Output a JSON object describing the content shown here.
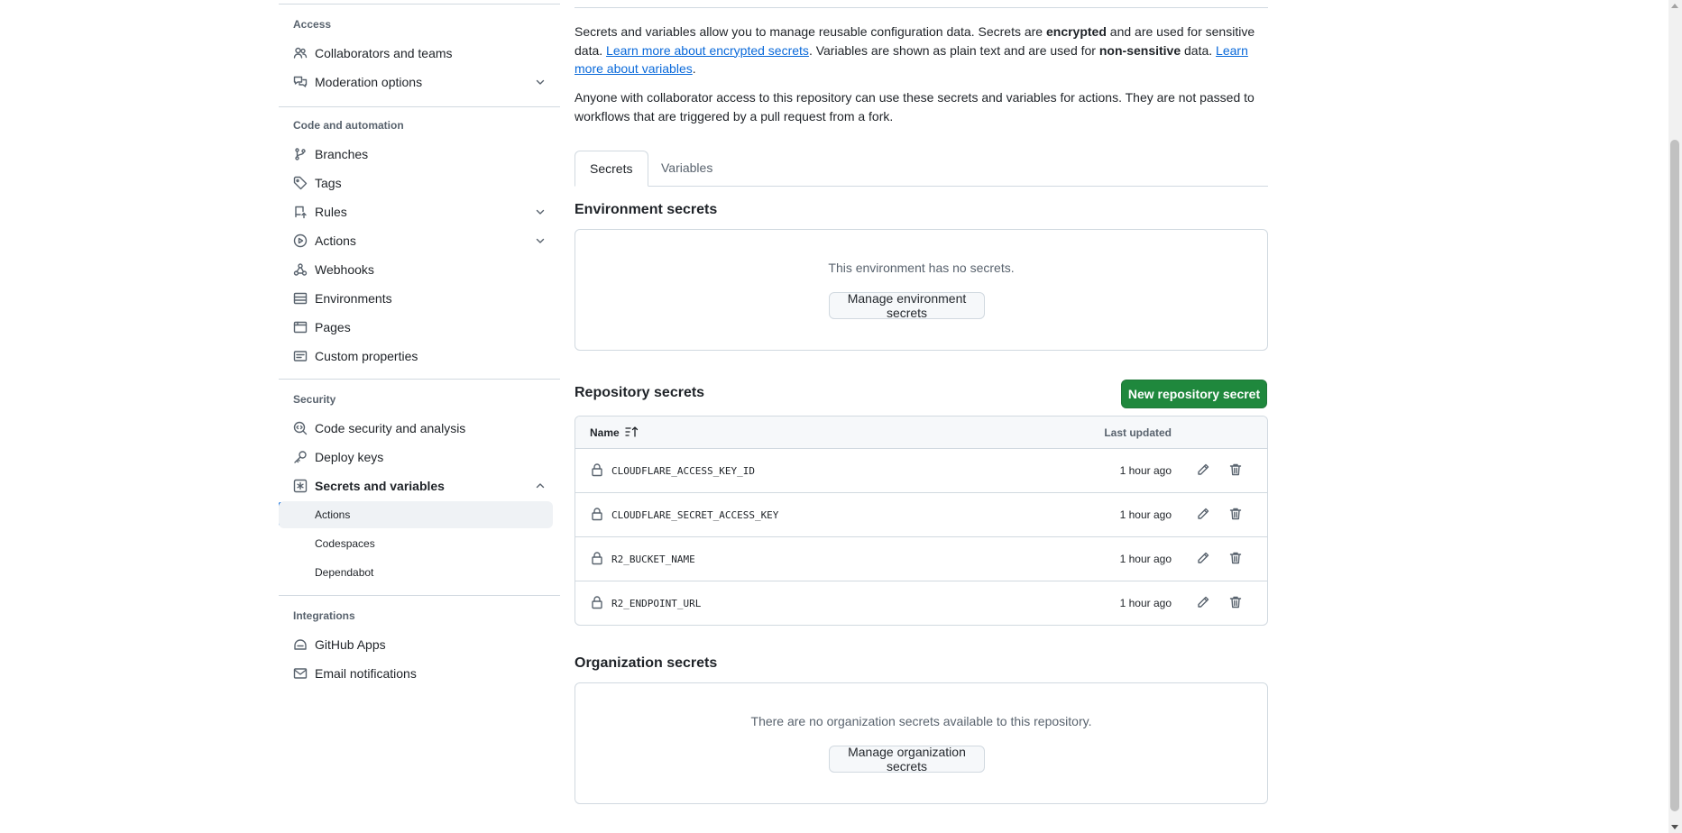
{
  "sidebar": {
    "access_heading": "Access",
    "access_items": [
      {
        "label": "Collaborators and teams",
        "icon": "people-icon"
      },
      {
        "label": "Moderation options",
        "icon": "comment-discussion-icon"
      }
    ],
    "code_heading": "Code and automation",
    "code_items": [
      {
        "label": "Branches",
        "icon": "git-branch-icon"
      },
      {
        "label": "Tags",
        "icon": "tag-icon"
      },
      {
        "label": "Rules",
        "icon": "repo-push-icon"
      },
      {
        "label": "Actions",
        "icon": "play-icon"
      },
      {
        "label": "Webhooks",
        "icon": "webhook-icon"
      },
      {
        "label": "Environments",
        "icon": "server-icon"
      },
      {
        "label": "Pages",
        "icon": "browser-icon"
      },
      {
        "label": "Custom properties",
        "icon": "note-icon"
      }
    ],
    "security_heading": "Security",
    "security_items": [
      {
        "label": "Code security and analysis",
        "icon": "codescan-icon"
      },
      {
        "label": "Deploy keys",
        "icon": "key-icon"
      },
      {
        "label": "Secrets and variables",
        "icon": "asterisk-icon"
      }
    ],
    "secrets_subitems": [
      "Actions",
      "Codespaces",
      "Dependabot"
    ],
    "integrations_heading": "Integrations",
    "integrations_items": [
      {
        "label": "GitHub Apps",
        "icon": "hubot-icon"
      },
      {
        "label": "Email notifications",
        "icon": "mail-icon"
      }
    ]
  },
  "intro": {
    "p1_a": "Secrets and variables allow you to manage reusable configuration data. Secrets are ",
    "p1_b": "encrypted",
    "p1_c": " and are used for sensitive data. ",
    "p1_link1": "Learn more about encrypted secrets",
    "p1_d": ". Variables are shown as plain text and are used for ",
    "p1_e": "non-sensitive",
    "p1_f": " data. ",
    "p1_link2": "Learn more about variables",
    "p1_g": ".",
    "p2": "Anyone with collaborator access to this repository can use these secrets and variables for actions. They are not passed to workflows that are triggered by a pull request from a fork."
  },
  "tabs": {
    "secrets": "Secrets",
    "variables": "Variables"
  },
  "environment": {
    "title": "Environment secrets",
    "empty_message": "This environment has no secrets.",
    "manage_button": "Manage environment secrets"
  },
  "repository": {
    "title": "Repository secrets",
    "new_button": "New repository secret",
    "col_name": "Name",
    "col_updated": "Last updated",
    "rows": [
      {
        "name": "CLOUDFLARE_ACCESS_KEY_ID",
        "updated": "1 hour ago"
      },
      {
        "name": "CLOUDFLARE_SECRET_ACCESS_KEY",
        "updated": "1 hour ago"
      },
      {
        "name": "R2_BUCKET_NAME",
        "updated": "1 hour ago"
      },
      {
        "name": "R2_ENDPOINT_URL",
        "updated": "1 hour ago"
      }
    ]
  },
  "organization": {
    "title": "Organization secrets",
    "empty_message": "There are no organization secrets available to this repository.",
    "manage_button": "Manage organization secrets"
  },
  "colors": {
    "accent": "#0969da",
    "primary_button": "#1f883d",
    "border": "#d1d9e0",
    "muted_text": "#59636e"
  }
}
